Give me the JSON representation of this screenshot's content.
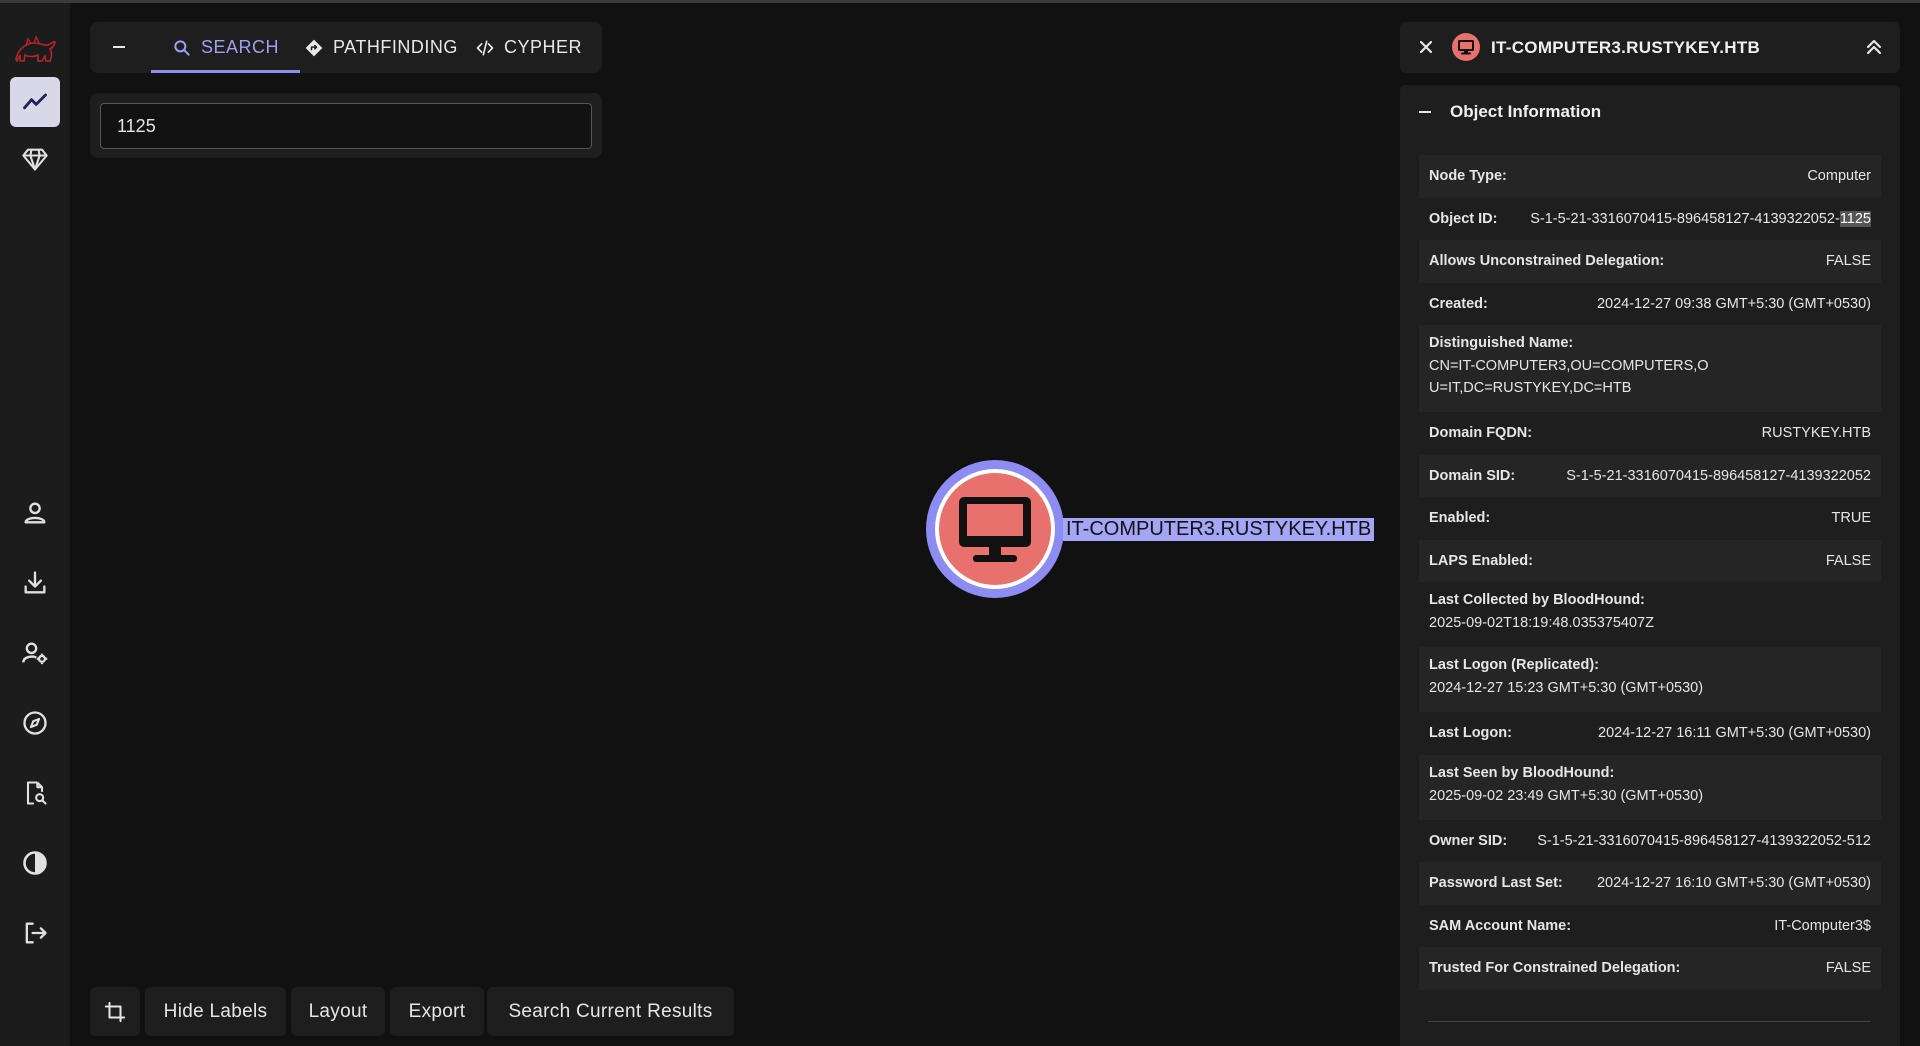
{
  "app": {
    "logo": "bloodhound-logo"
  },
  "sidebar": {
    "items": [
      {
        "name": "explore",
        "icon": "line-chart-icon",
        "active": true
      },
      {
        "name": "gem",
        "icon": "gem-icon"
      },
      {
        "name": "profile",
        "icon": "user-icon"
      },
      {
        "name": "download",
        "icon": "download-icon"
      },
      {
        "name": "administration",
        "icon": "user-gear-icon"
      },
      {
        "name": "docs",
        "icon": "compass-icon"
      },
      {
        "name": "file-search",
        "icon": "file-search-icon"
      },
      {
        "name": "theme",
        "icon": "contrast-icon"
      },
      {
        "name": "logout",
        "icon": "logout-icon"
      }
    ]
  },
  "tabs": {
    "search": "SEARCH",
    "pathfinding": "PATHFINDING",
    "cypher": "CYPHER"
  },
  "search": {
    "value": "1125"
  },
  "graph": {
    "node_label": "IT-COMPUTER3.RUSTYKEY.HTB",
    "node_icon": "desktop-icon",
    "node_color": "#e8706d",
    "selection_color": "#8c8cf2"
  },
  "toolbar": {
    "hide_labels": "Hide Labels",
    "layout": "Layout",
    "export": "Export",
    "search_current": "Search Current Results"
  },
  "panel": {
    "title": "IT-COMPUTER3.RUSTYKEY.HTB",
    "section": "Object Information",
    "rows": [
      {
        "key": "Node Type:",
        "value": "Computer"
      },
      {
        "key": "Object ID:",
        "value_prefix": "S-1-5-21-3316070415-896458127-4139322052-",
        "value_highlight": "1125"
      },
      {
        "key": "Allows Unconstrained Delegation:",
        "value": "FALSE"
      },
      {
        "key": "Created:",
        "value": "2024-12-27 09:38 GMT+5:30 (GMT+0530)"
      },
      {
        "key": "Distinguished Name:",
        "value": "CN=IT-COMPUTER3,OU=COMPUTERS,OU=IT,DC=RUSTYKEY,DC=HTB"
      },
      {
        "key": "Domain FQDN:",
        "value": "RUSTYKEY.HTB"
      },
      {
        "key": "Domain SID:",
        "value": "S-1-5-21-3316070415-896458127-4139322052"
      },
      {
        "key": "Enabled:",
        "value": "TRUE"
      },
      {
        "key": "LAPS Enabled:",
        "value": "FALSE"
      },
      {
        "key": "Last Collected by BloodHound:",
        "value": "2025-09-02T18:19:48.035375407Z"
      },
      {
        "key": "Last Logon (Replicated):",
        "value": "2024-12-27 15:23 GMT+5:30 (GMT+0530)"
      },
      {
        "key": "Last Logon:",
        "value": "2024-12-27 16:11 GMT+5:30 (GMT+0530)"
      },
      {
        "key": "Last Seen by BloodHound:",
        "value": "2025-09-02 23:49 GMT+5:30 (GMT+0530)"
      },
      {
        "key": "Owner SID:",
        "value": "S-1-5-21-3316070415-896458127-4139322052-512"
      },
      {
        "key": "Password Last Set:",
        "value": "2024-12-27 16:10 GMT+5:30 (GMT+0530)"
      },
      {
        "key": "SAM Account Name:",
        "value": "IT-Computer3$"
      },
      {
        "key": "Trusted For Constrained Delegation:",
        "value": "FALSE"
      }
    ]
  }
}
